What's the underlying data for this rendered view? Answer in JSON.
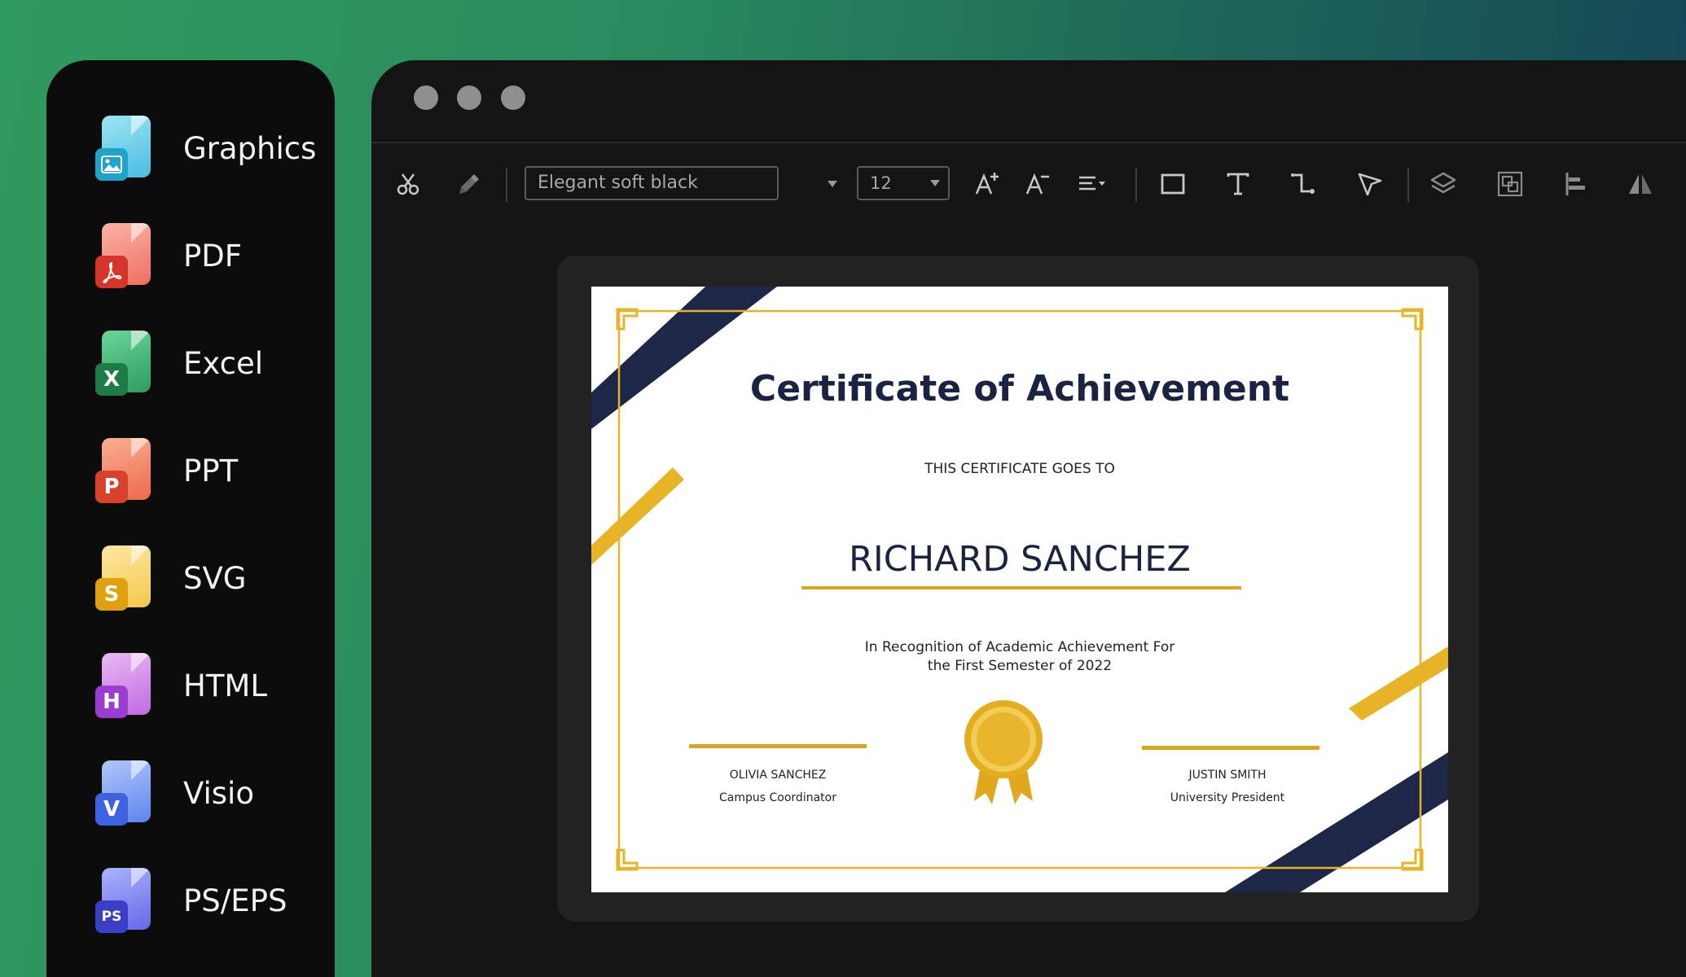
{
  "sidebar": {
    "items": [
      {
        "label": "Graphics",
        "badge": "",
        "icon": "graphics-file-icon",
        "color": "#5fc3e4",
        "badge_color": "#1fa3c9"
      },
      {
        "label": "PDF",
        "badge": "",
        "icon": "pdf-file-icon",
        "color": "#f2887a",
        "badge_color": "#d6352a"
      },
      {
        "label": "Excel",
        "badge": "X",
        "icon": "excel-file-icon",
        "color": "#43b97a",
        "badge_color": "#1d7b45"
      },
      {
        "label": "PPT",
        "badge": "P",
        "icon": "ppt-file-icon",
        "color": "#f07a5c",
        "badge_color": "#d9412a"
      },
      {
        "label": "SVG",
        "badge": "S",
        "icon": "svg-file-icon",
        "color": "#f6d06d",
        "badge_color": "#e0a010"
      },
      {
        "label": "HTML",
        "badge": "H",
        "icon": "html-file-icon",
        "color": "#d58ae8",
        "badge_color": "#9b3dd0"
      },
      {
        "label": "Visio",
        "badge": "V",
        "icon": "visio-file-icon",
        "color": "#7b9cf2",
        "badge_color": "#3f63e0"
      },
      {
        "label": "PS/EPS",
        "badge": "PS",
        "icon": "ps-eps-file-icon",
        "color": "#7f8ef0",
        "badge_color": "#3b3fc8"
      }
    ]
  },
  "toolbar": {
    "font_name": "Elegant soft black",
    "font_size": "12"
  },
  "certificate": {
    "title": "Certificate of Achievement",
    "subtitle": "THIS CERTIFICATE GOES TO",
    "recipient": "RICHARD SANCHEZ",
    "recognition_line1": "In Recognition of Academic Achievement For",
    "recognition_line2": "the First Semester of 2022",
    "signer_left_name": "OLIVIA SANCHEZ",
    "signer_left_role": "Campus Coordinator",
    "signer_right_name": "JUSTIN SMITH",
    "signer_right_role": "University President"
  },
  "colors": {
    "navy": "#1f2748",
    "gold": "#e7b428",
    "window_bg": "#141414"
  }
}
